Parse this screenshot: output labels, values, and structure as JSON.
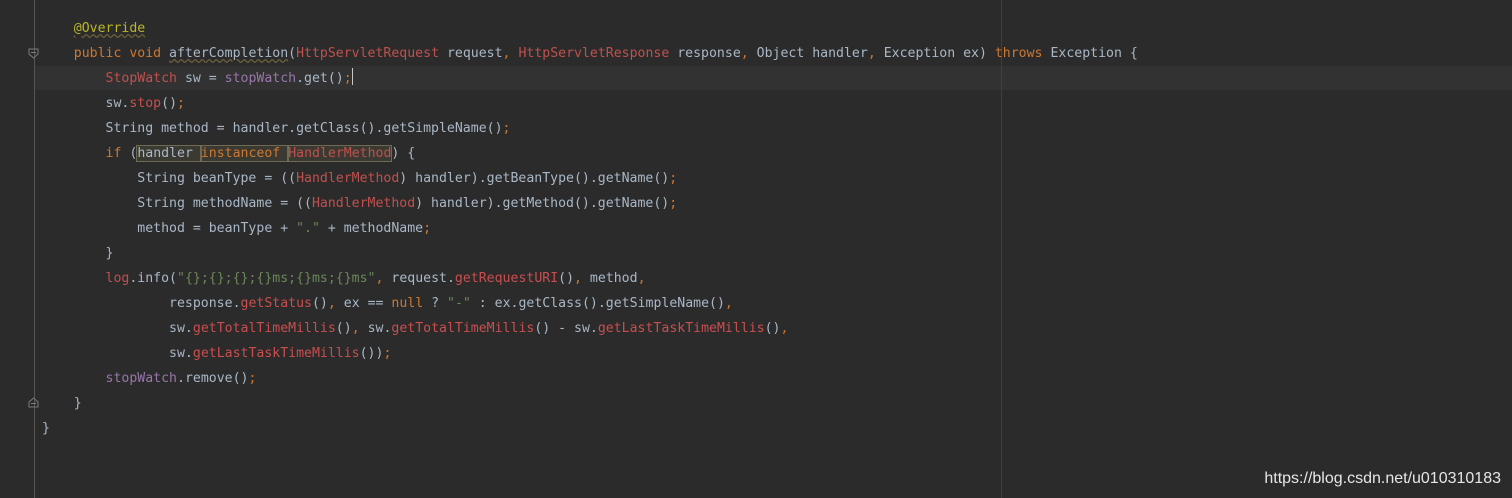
{
  "editor": {
    "theme_colors": {
      "background": "#2B2B2B",
      "current_line": "#323232",
      "keyword": "#CC7832",
      "annotation": "#BBB529",
      "class_ref": "#C0504D",
      "field": "#9876AA",
      "string": "#6A8759",
      "default": "#A9B7C6"
    },
    "lines": [
      [
        {
          "t": "    "
        },
        {
          "t": "@Override",
          "c": "ann",
          "wavy": true
        }
      ],
      [
        {
          "t": "    "
        },
        {
          "t": "public void ",
          "c": "kw"
        },
        {
          "t": "afterCompletion",
          "c": "def",
          "wavy": true
        },
        {
          "t": "("
        },
        {
          "t": "HttpServletRequest",
          "c": "cls"
        },
        {
          "t": " request"
        },
        {
          "t": ", ",
          "c": "punc"
        },
        {
          "t": "HttpServletResponse",
          "c": "cls"
        },
        {
          "t": " response"
        },
        {
          "t": ", ",
          "c": "punc"
        },
        {
          "t": "Object handler"
        },
        {
          "t": ", ",
          "c": "punc"
        },
        {
          "t": "Exception ex) "
        },
        {
          "t": "throws ",
          "c": "kw"
        },
        {
          "t": "Exception {"
        }
      ],
      [
        {
          "t": "        "
        },
        {
          "t": "StopWatch",
          "c": "cls"
        },
        {
          "t": " sw = "
        },
        {
          "t": "stopWatch",
          "c": "fld"
        },
        {
          "t": ".get()"
        },
        {
          "t": ";",
          "c": "punc"
        },
        {
          "caret": true
        }
      ],
      [
        {
          "t": "        "
        },
        {
          "t": "sw."
        },
        {
          "t": "stop",
          "c": "meth"
        },
        {
          "t": "()"
        },
        {
          "t": ";",
          "c": "punc"
        }
      ],
      [
        {
          "t": "        "
        },
        {
          "t": "String method = handler.getClass().getSimpleName()"
        },
        {
          "t": ";",
          "c": "punc"
        }
      ],
      [
        {
          "t": "        "
        },
        {
          "t": "if ",
          "c": "kw"
        },
        {
          "t": "("
        },
        {
          "t": "handler ",
          "hl": true
        },
        {
          "t": "instanceof ",
          "c": "kw",
          "hl": true
        },
        {
          "t": "HandlerMethod",
          "c": "cls",
          "hl": true
        },
        {
          "t": ") {"
        }
      ],
      [
        {
          "t": "            "
        },
        {
          "t": "String beanType = (("
        },
        {
          "t": "HandlerMethod",
          "c": "cls"
        },
        {
          "t": ") handler).getBeanType().getName()"
        },
        {
          "t": ";",
          "c": "punc"
        }
      ],
      [
        {
          "t": "            "
        },
        {
          "t": "String methodName = (("
        },
        {
          "t": "HandlerMethod",
          "c": "cls"
        },
        {
          "t": ") handler).getMethod().getName()"
        },
        {
          "t": ";",
          "c": "punc"
        }
      ],
      [
        {
          "t": "            "
        },
        {
          "t": "method = beanType + "
        },
        {
          "t": "\".\"",
          "c": "str"
        },
        {
          "t": " + methodName"
        },
        {
          "t": ";",
          "c": "punc"
        }
      ],
      [
        {
          "t": "        "
        },
        {
          "t": "}"
        }
      ],
      [
        {
          "t": "        "
        },
        {
          "t": "log",
          "c": "cls"
        },
        {
          "t": ".info("
        },
        {
          "t": "\"{};{};{};{}ms;{}ms;{}ms\"",
          "c": "str"
        },
        {
          "t": ", ",
          "c": "punc"
        },
        {
          "t": "request."
        },
        {
          "t": "getRequestURI",
          "c": "meth"
        },
        {
          "t": "()"
        },
        {
          "t": ", ",
          "c": "punc"
        },
        {
          "t": "method"
        },
        {
          "t": ",",
          "c": "punc"
        }
      ],
      [
        {
          "t": "                "
        },
        {
          "t": "response."
        },
        {
          "t": "getStatus",
          "c": "meth"
        },
        {
          "t": "()"
        },
        {
          "t": ", ",
          "c": "punc"
        },
        {
          "t": "ex == "
        },
        {
          "t": "null ",
          "c": "kw"
        },
        {
          "t": "? "
        },
        {
          "t": "\"-\"",
          "c": "str"
        },
        {
          "t": " : ex.getClass().getSimpleName()"
        },
        {
          "t": ",",
          "c": "punc"
        }
      ],
      [
        {
          "t": "                "
        },
        {
          "t": "sw."
        },
        {
          "t": "getTotalTimeMillis",
          "c": "meth"
        },
        {
          "t": "()"
        },
        {
          "t": ", ",
          "c": "punc"
        },
        {
          "t": "sw."
        },
        {
          "t": "getTotalTimeMillis",
          "c": "meth"
        },
        {
          "t": "() - sw."
        },
        {
          "t": "getLastTaskTimeMillis",
          "c": "meth"
        },
        {
          "t": "()"
        },
        {
          "t": ",",
          "c": "punc"
        }
      ],
      [
        {
          "t": "                "
        },
        {
          "t": "sw."
        },
        {
          "t": "getLastTaskTimeMillis",
          "c": "meth"
        },
        {
          "t": "())"
        },
        {
          "t": ";",
          "c": "punc"
        }
      ],
      [
        {
          "t": "        "
        },
        {
          "t": "stopWatch",
          "c": "fld"
        },
        {
          "t": ".remove()"
        },
        {
          "t": ";",
          "c": "punc"
        }
      ],
      [
        {
          "t": "    "
        },
        {
          "t": "}"
        }
      ],
      [
        {
          "t": "}"
        }
      ]
    ]
  },
  "watermark": "https://blog.csdn.net/u010310183"
}
